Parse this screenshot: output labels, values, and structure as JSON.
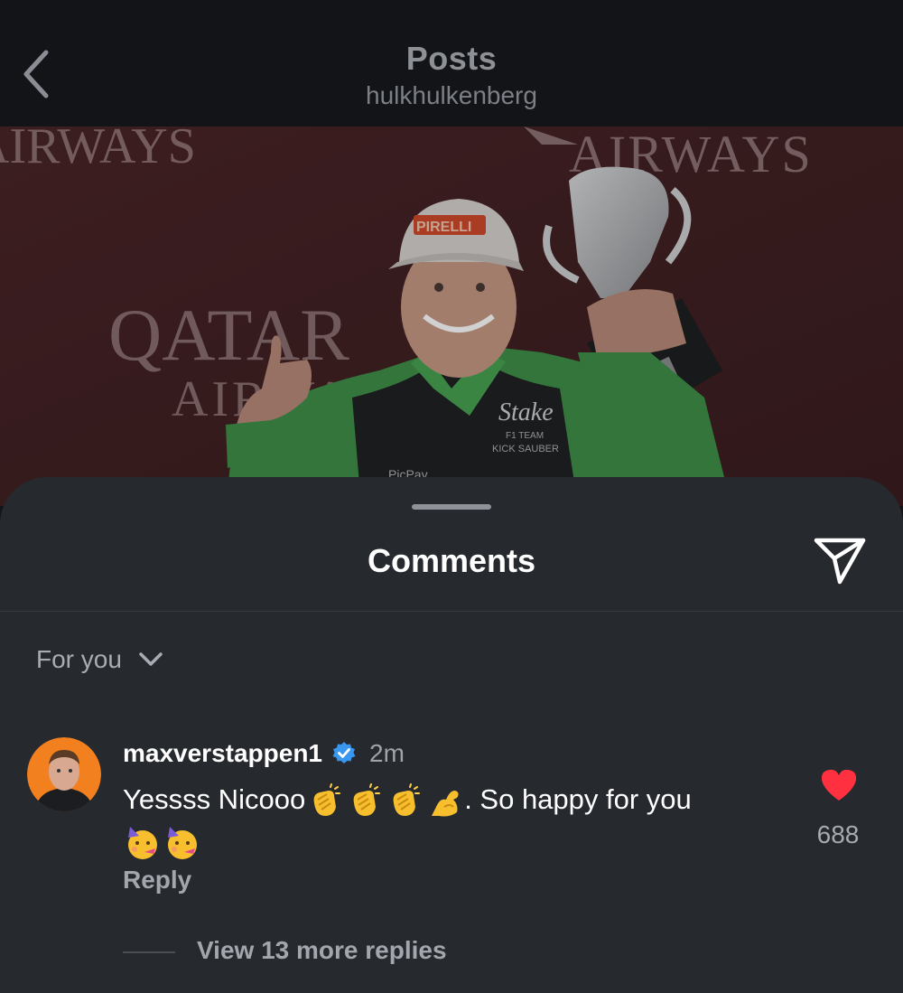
{
  "header": {
    "title": "Posts",
    "subtitle": "hulkhulkenberg",
    "back_icon": "chevron-left-icon"
  },
  "post_image": {
    "description_icon": "photo",
    "backdrop_texts": [
      "QATAR",
      "AIRWAYS",
      "AIRWAYS"
    ],
    "cap_text": "PIRELLI",
    "suit_texts": [
      "Stake",
      "F1 TEAM",
      "KICK SAUBER",
      "PicPay"
    ]
  },
  "comments_sheet": {
    "title": "Comments",
    "share_icon": "send-icon",
    "sort_label": "For you",
    "sort_icon": "chevron-down-icon"
  },
  "comment": {
    "username": "maxverstappen1",
    "verified": true,
    "time": "2m",
    "text_prefix": "Yessss Nicooo",
    "text_suffix": ". So happy for you",
    "emojis_line1": [
      "clapping-hands",
      "clapping-hands",
      "clapping-hands",
      "flexed-biceps"
    ],
    "emojis_line2": [
      "partying-face",
      "partying-face"
    ],
    "likes": "688",
    "like_icon": "heart-icon",
    "reply_label": "Reply",
    "view_replies_label": "View 13 more replies"
  },
  "colors": {
    "background": "#121417",
    "sheet": "#26292e",
    "accent_heart": "#ff3040",
    "verified_badge": "#3897f0",
    "suit_green": "#4fae5a"
  }
}
